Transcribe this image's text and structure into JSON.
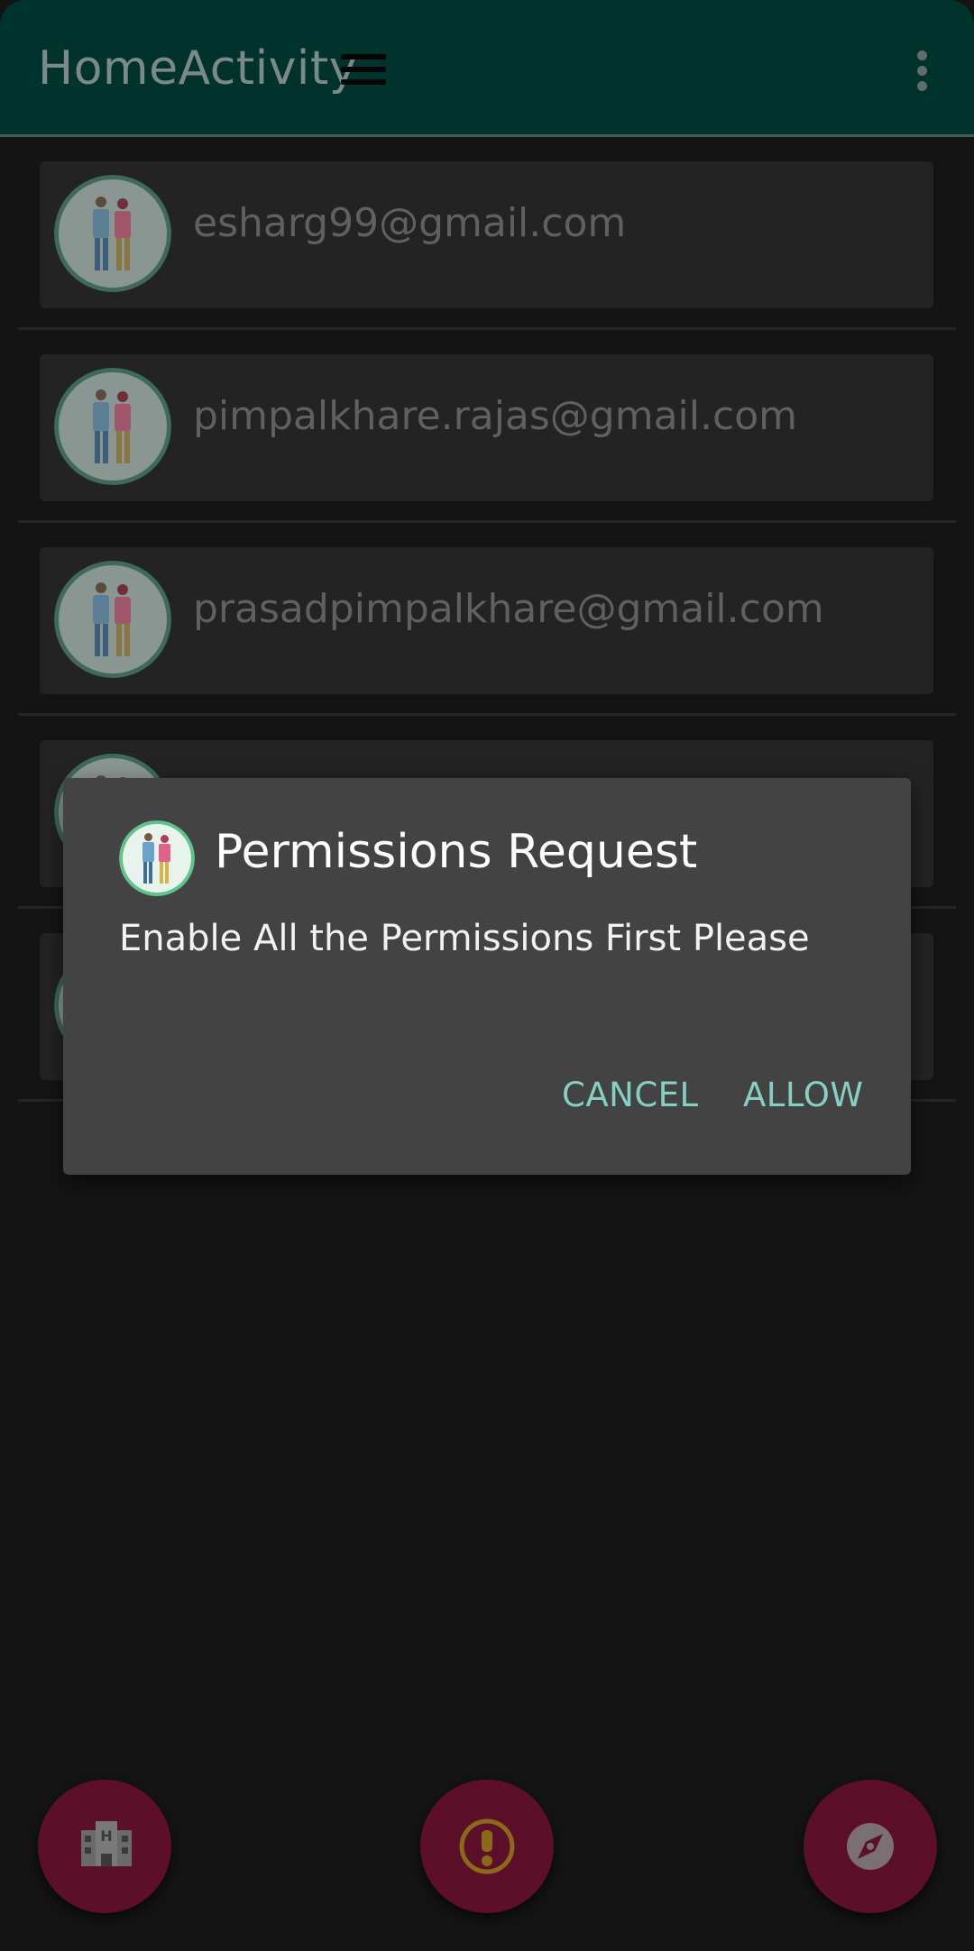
{
  "appbar": {
    "title": "HomeActivity",
    "menu_icon": "hamburger-menu-icon",
    "overflow_icon": "more-vert-icon"
  },
  "accounts": [
    {
      "email": "esharg99@gmail.com"
    },
    {
      "email": "pimpalkhare.rajas@gmail.com"
    },
    {
      "email": "prasadpimpalkhare@gmail.com"
    },
    {
      "email": ""
    },
    {
      "email": ""
    }
  ],
  "dialog": {
    "title": "Permissions Request",
    "message": "Enable All the Permissions First Please",
    "cancel_label": "CANCEL",
    "allow_label": "ALLOW"
  },
  "fabs": {
    "left_icon": "hotel-building-icon",
    "middle_icon": "alert-exclamation-icon",
    "right_icon": "compass-icon"
  },
  "colors": {
    "appbar": "#00332c",
    "accent": "#86cfc4",
    "fab": "#5c0f28",
    "dialog": "#434343"
  }
}
